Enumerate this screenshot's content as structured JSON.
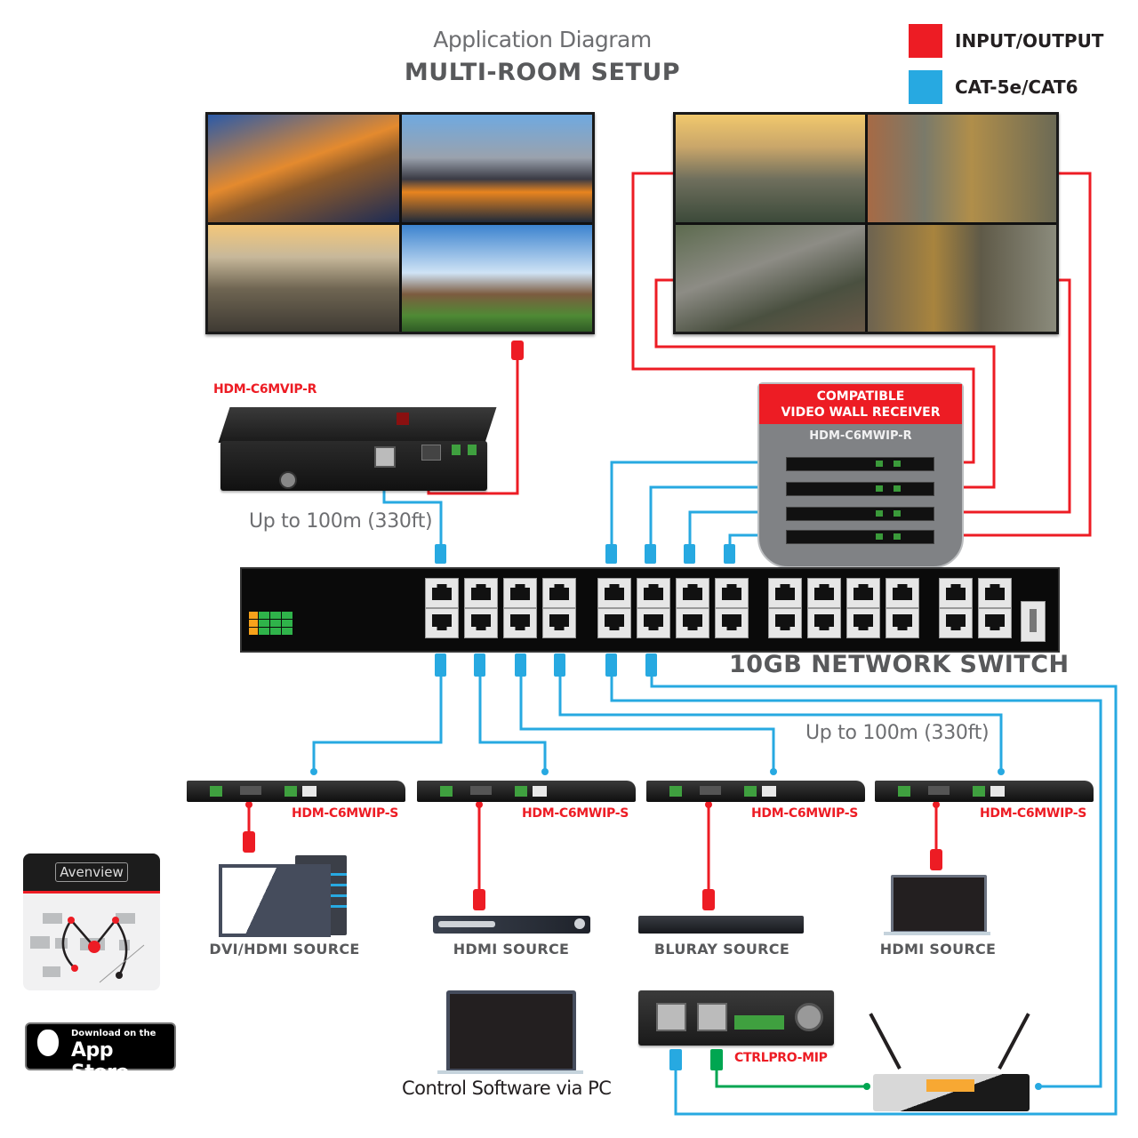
{
  "header": {
    "subtitle": "Application Diagram",
    "title": "MULTI-ROOM SETUP"
  },
  "legend": [
    {
      "label": "INPUT/OUTPUT",
      "color": "#ed1c24"
    },
    {
      "label": "CAT-5e/CAT6",
      "color": "#27a9e1"
    }
  ],
  "colors": {
    "hdmi": "#ed1c24",
    "cat": "#27a9e1",
    "control": "#00a651",
    "text_gray": "#58595b"
  },
  "displays": {
    "multiview": {
      "tiles": [
        "bridge-at-sunset",
        "canal-bridge",
        "city-skyline",
        "windmill"
      ]
    },
    "videowall": {
      "tiles": [
        "skyline-top-left",
        "skyline-top-right",
        "skyline-bottom-left",
        "skyline-bottom-right"
      ]
    }
  },
  "receiver": {
    "model": "HDM-C6MVIP-R",
    "distance": "Up to 100m (330ft)"
  },
  "videowall_receiver": {
    "heading_line1": "COMPATIBLE",
    "heading_line2": "VIDEO WALL RECEIVER",
    "model": "HDM-C6MWIP-R",
    "unit_count": 4
  },
  "switch": {
    "label": "10GB NETWORK SWITCH",
    "port_groups": [
      4,
      4,
      4,
      2
    ]
  },
  "transmitters": {
    "distance": "Up to 100m (330ft)",
    "units": [
      {
        "model": "HDM-C6MWIP-S",
        "source": "DVI/HDMI SOURCE"
      },
      {
        "model": "HDM-C6MWIP-S",
        "source": "HDMI SOURCE"
      },
      {
        "model": "HDM-C6MWIP-S",
        "source": "BLURAY SOURCE"
      },
      {
        "model": "HDM-C6MWIP-S",
        "source": "HDMI SOURCE"
      }
    ]
  },
  "app": {
    "brand": "Avenview",
    "store_line1": "Download on the",
    "store_line2": "App Store"
  },
  "control": {
    "pc_label": "Control Software via PC",
    "controller_model": "CTRLPRO-MIP"
  }
}
